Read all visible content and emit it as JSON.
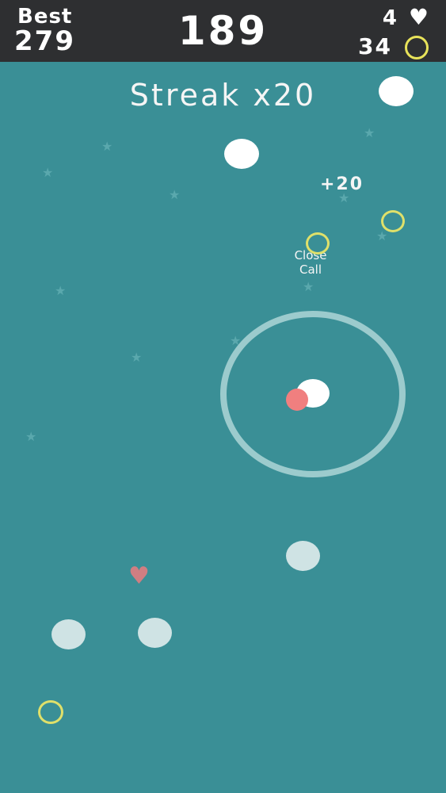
{
  "hud": {
    "best_label": "Best",
    "best_value": "279",
    "score": "189",
    "lives": "4",
    "coins": "34"
  },
  "messages": {
    "streak": "Streak x20",
    "points_popup": "+20",
    "close_call_line1": "Close",
    "close_call_line2": "Call"
  },
  "icons": {
    "lives": "heart-icon",
    "coins": "coin-ring-icon",
    "pickup": "heart-pickup-icon"
  },
  "colors": {
    "background": "#3a8f96",
    "topbar": "#2e2f31",
    "coin_ring": "#e8e35a",
    "player": "#f07f7f"
  }
}
